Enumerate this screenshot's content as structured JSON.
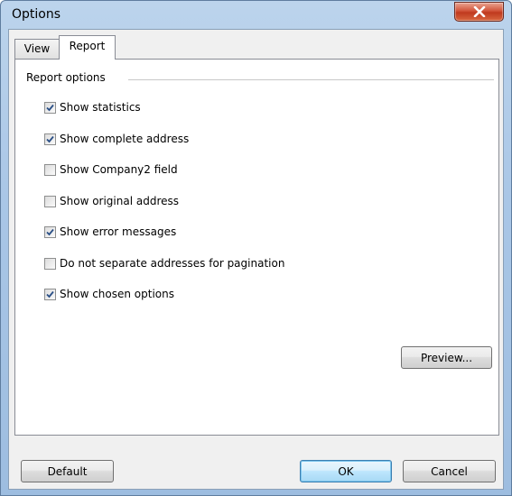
{
  "window": {
    "title": "Options"
  },
  "tabs": [
    {
      "label": "View",
      "selected": false
    },
    {
      "label": "Report",
      "selected": true
    }
  ],
  "report": {
    "group_label": "Report options",
    "options": [
      {
        "label": "Show statistics",
        "checked": true
      },
      {
        "label": "Show complete address",
        "checked": true
      },
      {
        "label": "Show Company2 field",
        "checked": false
      },
      {
        "label": "Show original address",
        "checked": false
      },
      {
        "label": "Show error messages",
        "checked": true
      },
      {
        "label": "Do not separate addresses for pagination",
        "checked": false
      },
      {
        "label": "Show chosen options",
        "checked": true
      }
    ],
    "preview_label": "Preview..."
  },
  "footer": {
    "default_label": "Default",
    "ok_label": "OK",
    "cancel_label": "Cancel"
  },
  "colors": {
    "title_gradient_top": "#bcd4ec",
    "close_red": "#c0391e",
    "focus_border": "#3c7fb1",
    "check_blue": "#2a4f86"
  }
}
